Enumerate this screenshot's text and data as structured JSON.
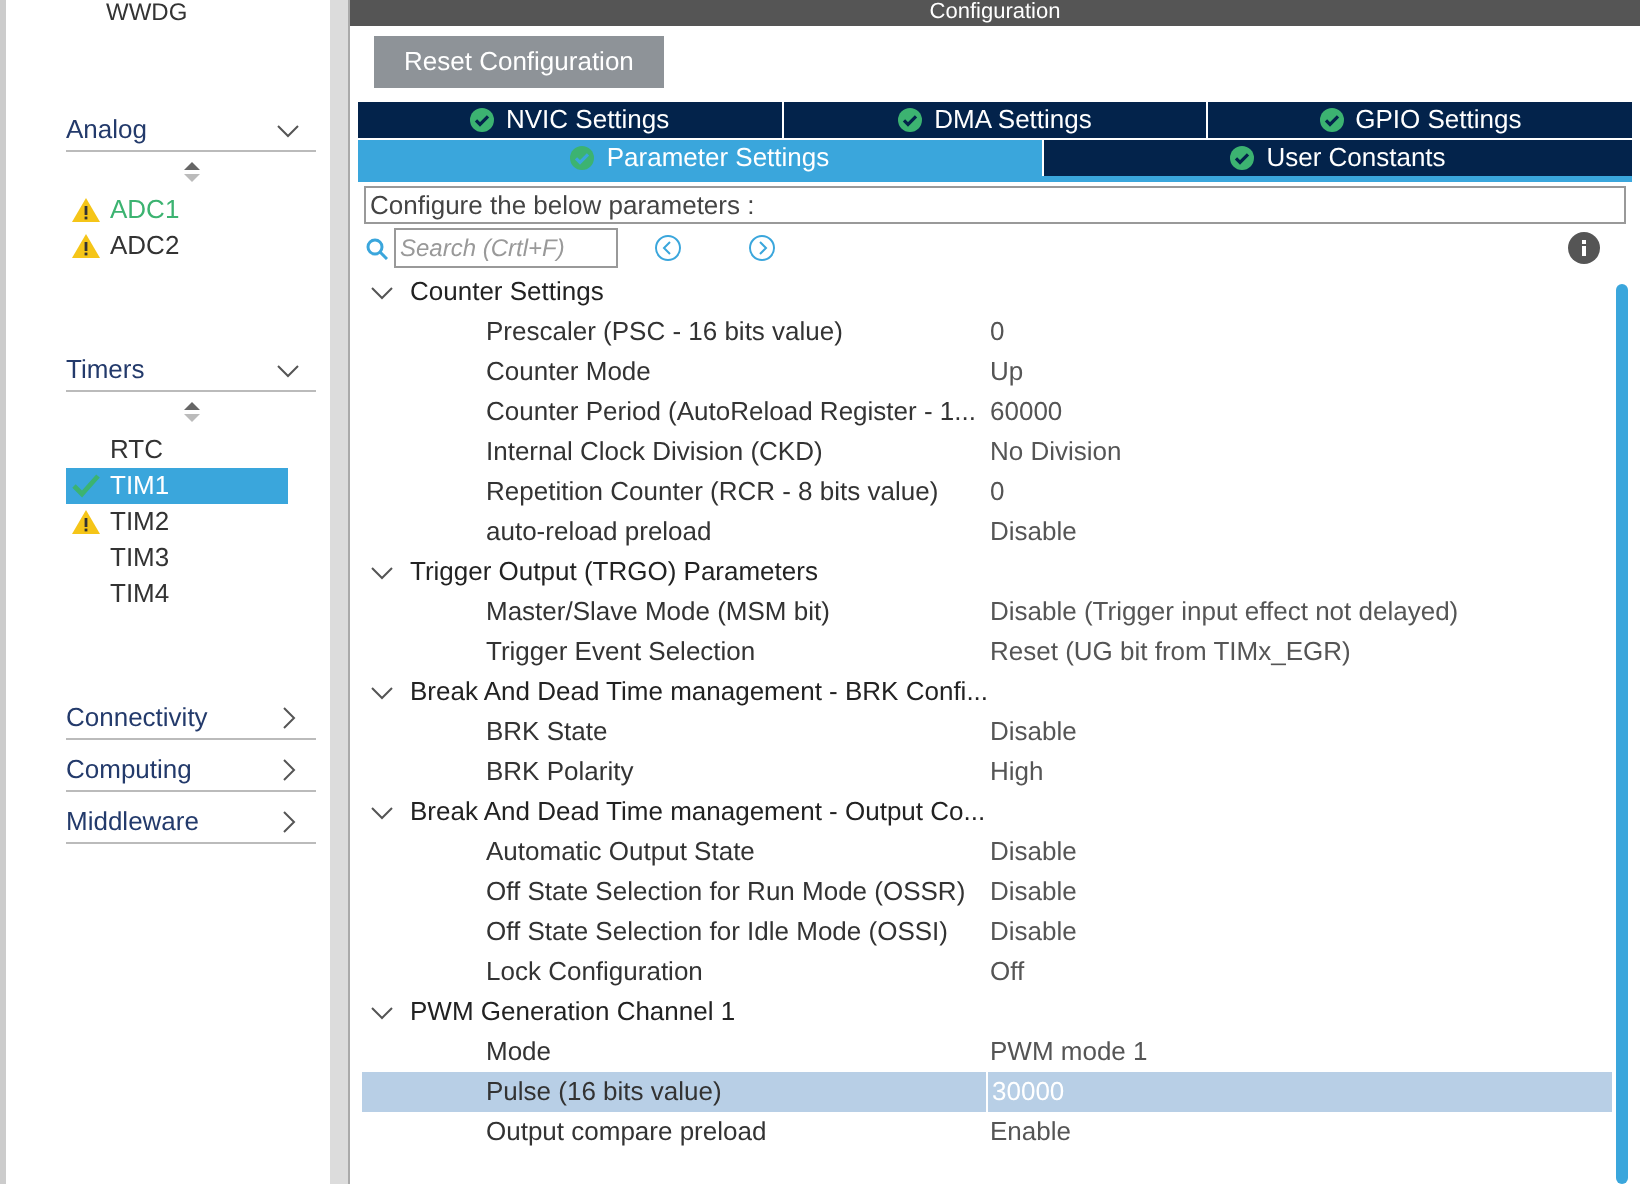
{
  "sidebar": {
    "top_item": "WWDG",
    "sections": [
      {
        "title": "Analog",
        "expanded": true,
        "items": [
          {
            "label": "ADC1",
            "kind": "warning",
            "active": true,
            "selected": false
          },
          {
            "label": "ADC2",
            "kind": "warning",
            "active": false,
            "selected": false
          }
        ]
      },
      {
        "title": "Timers",
        "expanded": true,
        "items": [
          {
            "label": "RTC",
            "kind": "plain",
            "active": false,
            "selected": false
          },
          {
            "label": "TIM1",
            "kind": "ok",
            "active": false,
            "selected": true
          },
          {
            "label": "TIM2",
            "kind": "warning",
            "active": false,
            "selected": false
          },
          {
            "label": "TIM3",
            "kind": "plain",
            "active": false,
            "selected": false
          },
          {
            "label": "TIM4",
            "kind": "plain",
            "active": false,
            "selected": false
          }
        ]
      },
      {
        "title": "Connectivity",
        "expanded": false
      },
      {
        "title": "Computing",
        "expanded": false
      },
      {
        "title": "Middleware",
        "expanded": false
      }
    ]
  },
  "panel": {
    "title": "Configuration",
    "reset_button": "Reset Configuration",
    "tab_rows": [
      [
        {
          "label": "NVIC Settings",
          "selected": false
        },
        {
          "label": "DMA Settings",
          "selected": false
        },
        {
          "label": "GPIO Settings",
          "selected": false
        }
      ],
      [
        {
          "label": "Parameter Settings",
          "selected": true
        },
        {
          "label": "User Constants",
          "selected": false
        }
      ]
    ],
    "description": "Configure the below parameters :",
    "search": {
      "placeholder": "Search (Crtl+F)"
    },
    "groups": [
      {
        "name": "Counter Settings",
        "expanded": true,
        "children": [
          {
            "name": "Prescaler (PSC - 16 bits value)",
            "value": "0",
            "selected": false
          },
          {
            "name": "Counter Mode",
            "value": "Up",
            "selected": false
          },
          {
            "name": "Counter Period (AutoReload Register - 1...",
            "value": "60000",
            "selected": false
          },
          {
            "name": "Internal Clock Division (CKD)",
            "value": "No Division",
            "selected": false
          },
          {
            "name": "Repetition Counter (RCR - 8 bits value)",
            "value": "0",
            "selected": false
          },
          {
            "name": "auto-reload preload",
            "value": "Disable",
            "selected": false
          }
        ]
      },
      {
        "name": "Trigger Output (TRGO) Parameters",
        "expanded": true,
        "children": [
          {
            "name": "Master/Slave Mode (MSM bit)",
            "value": "Disable (Trigger input effect not delayed)",
            "selected": false
          },
          {
            "name": "Trigger Event Selection",
            "value": "Reset (UG bit from TIMx_EGR)",
            "selected": false
          }
        ]
      },
      {
        "name": "Break And Dead Time management - BRK Confi...",
        "expanded": true,
        "children": [
          {
            "name": "BRK State",
            "value": "Disable",
            "selected": false
          },
          {
            "name": "BRK Polarity",
            "value": "High",
            "selected": false
          }
        ]
      },
      {
        "name": "Break And Dead Time management - Output Co...",
        "expanded": true,
        "children": [
          {
            "name": "Automatic Output State",
            "value": "Disable",
            "selected": false
          },
          {
            "name": "Off State Selection for Run Mode (OSSR)",
            "value": "Disable",
            "selected": false
          },
          {
            "name": "Off State Selection for Idle Mode (OSSI)",
            "value": "Disable",
            "selected": false
          },
          {
            "name": "Lock Configuration",
            "value": "Off",
            "selected": false
          }
        ]
      },
      {
        "name": "PWM Generation Channel 1",
        "expanded": true,
        "children": [
          {
            "name": "Mode",
            "value": "PWM mode 1",
            "selected": false
          },
          {
            "name": "Pulse (16 bits value)",
            "value": "30000",
            "selected": true
          },
          {
            "name": "Output compare preload",
            "value": "Enable",
            "selected": false
          }
        ]
      }
    ]
  }
}
